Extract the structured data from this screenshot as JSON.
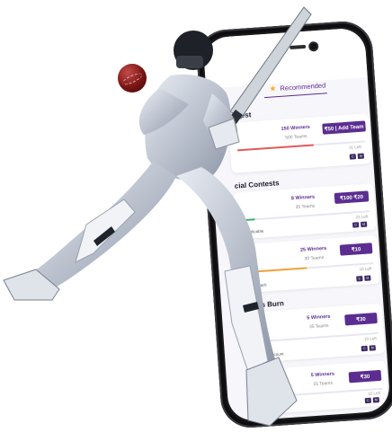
{
  "screen": {
    "tab_label": "Recommended",
    "sections": [
      {
        "title": "ontest"
      },
      {
        "title": "cial Contests"
      },
      {
        "title": "Bonus Burn"
      }
    ],
    "cards": [
      {
        "winners": "150 Winners",
        "teams": "500 Teams",
        "button": "₹50 | Add Team",
        "left": "3L Left",
        "prize": "",
        "note": "",
        "tags": [
          "C",
          "M"
        ]
      },
      {
        "winners": "8 Winners",
        "teams": "35 Teams",
        "button": "₹100 ₹20",
        "left": "33 Left",
        "prize": "",
        "note": "Applicable",
        "tags": [
          "C",
          "M"
        ]
      },
      {
        "winners": "25 Winners",
        "teams": "30 Teams",
        "button": "₹10",
        "left": "10 Left",
        "prize": "00",
        "note": "Cashback",
        "tags": [
          "C",
          "M"
        ]
      },
      {
        "winners": "5 Winners",
        "teams": "35 Teams",
        "button": "₹30",
        "left": "10 Left",
        "prize": "00",
        "note": "Discount",
        "tags": [
          "C",
          "M"
        ]
      },
      {
        "winners": "5 Winners",
        "teams": "25 Teams",
        "button": "₹30",
        "left": "15 Left",
        "prize": "",
        "note": "Filling",
        "tags": [
          "C",
          "M"
        ]
      }
    ]
  },
  "colors": {
    "brand": "#5b2d90",
    "ball": "#7a1414",
    "phone": "#1b1b1e"
  }
}
